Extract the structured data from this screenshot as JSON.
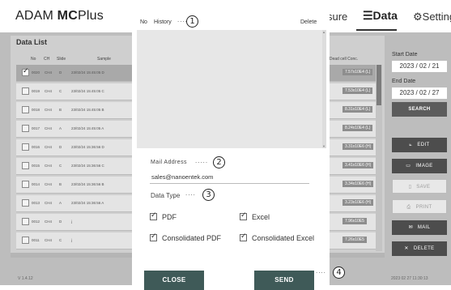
{
  "header": {
    "title_regular": "ADAM ",
    "title_bold": "MC",
    "title_suffix": "Plus",
    "tab_measure": "sure",
    "tab_data": "☰Data",
    "tab_setting": "⚙Setting"
  },
  "list": {
    "title": "Data List",
    "columns": {
      "no": "No",
      "ch": "CH",
      "slide": "Slide",
      "sample": "Sample",
      "dead": "c.Dead cell Conc."
    },
    "rows": [
      {
        "no": "0020",
        "ch": "CH4",
        "slide": "D",
        "sample": "23/02/24 15:45:05 D",
        "dead": "7.57x10E4 (L)",
        "selected": true
      },
      {
        "no": "0019",
        "ch": "CH4",
        "slide": "C",
        "sample": "23/02/24 15:45:05 C",
        "dead": "7.53x10E4 (L)",
        "selected": false
      },
      {
        "no": "0018",
        "ch": "CH4",
        "slide": "B",
        "sample": "23/02/24 15:45:05 B",
        "dead": "8.31x10E4 (L)",
        "selected": false
      },
      {
        "no": "0017",
        "ch": "CH4",
        "slide": "A",
        "sample": "23/02/24 15:45:05 A",
        "dead": "8.24x10E4 (L)",
        "selected": false
      },
      {
        "no": "0016",
        "ch": "CH4",
        "slide": "D",
        "sample": "23/02/24 15:36:56 D",
        "dead": "3.31x10E6 (H)",
        "selected": false
      },
      {
        "no": "0015",
        "ch": "CH4",
        "slide": "C",
        "sample": "23/02/24 15:36:56 C",
        "dead": "3.41x10E6 (H)",
        "selected": false
      },
      {
        "no": "0014",
        "ch": "CH4",
        "slide": "B",
        "sample": "23/02/24 15:36:56 B",
        "dead": "3.34x10E6 (H)",
        "selected": false
      },
      {
        "no": "0013",
        "ch": "CH4",
        "slide": "A",
        "sample": "23/02/24 15:36:56 A",
        "dead": "3.23x10E6 (H)",
        "selected": false
      },
      {
        "no": "0012",
        "ch": "CH4",
        "slide": "D",
        "sample": "j",
        "dead": "7.96x10E5",
        "selected": false
      },
      {
        "no": "0011",
        "ch": "CH4",
        "slide": "C",
        "sample": "j",
        "dead": "7.26x10E5",
        "selected": false
      }
    ],
    "version": "V 1.4.12",
    "timestamp": "2023 02 27 11:30:13"
  },
  "filter": {
    "start_label": "Start Date",
    "start_value": "2023 / 02 / 21",
    "end_label": "End Date",
    "end_value": "2023 / 02 / 27",
    "search": "SEARCH"
  },
  "side_buttons": {
    "edit": "EDIT",
    "image": "IMAGE",
    "save": "SAVE",
    "print": "PRINT",
    "mail": "MAIL",
    "delete": "DELETE"
  },
  "dialog": {
    "col_no": "No",
    "col_history": "History",
    "col_delete": "Delete",
    "mail_label": "Mail Address",
    "mail_value": "sales@nanoentek.com",
    "type_label": "Data Type",
    "options": {
      "pdf": "PDF",
      "excel": "Excel",
      "cons_pdf": "Consolidated PDF",
      "cons_excel": "Consolidated Excel"
    },
    "close": "CLOSE",
    "send": "SEND"
  },
  "annotations": {
    "a1": "1",
    "a2": "2",
    "a3": "3",
    "a4": "4"
  }
}
